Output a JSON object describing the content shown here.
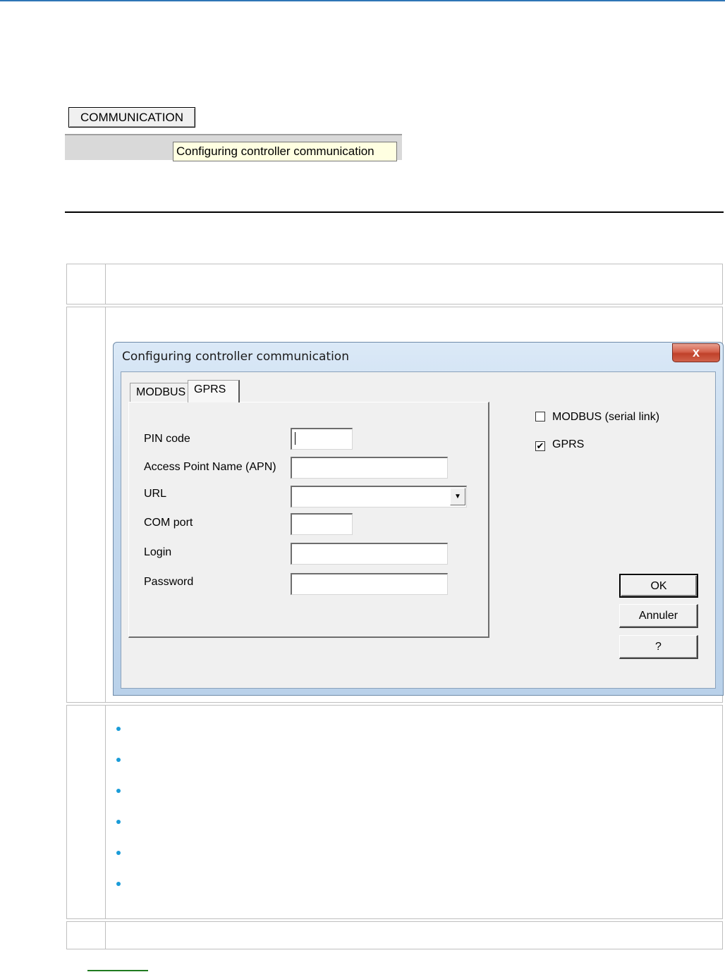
{
  "toolbar": {
    "communication_button": "COMMUNICATION",
    "tooltip": "Configuring controller communication"
  },
  "dialog": {
    "title": "Configuring controller communication",
    "close_label": "x",
    "tabs": [
      {
        "label": "MODBUS"
      },
      {
        "label": "GPRS"
      }
    ],
    "fields": {
      "pin_code": {
        "label": "PIN code",
        "value": ""
      },
      "apn": {
        "label": "Access Point Name (APN)",
        "value": ""
      },
      "url": {
        "label": "URL",
        "value": ""
      },
      "com_port": {
        "label": "COM port",
        "value": ""
      },
      "login": {
        "label": "Login",
        "value": ""
      },
      "password": {
        "label": "Password",
        "value": ""
      }
    },
    "checkboxes": {
      "modbus": {
        "label": "MODBUS (serial link)",
        "checked": false,
        "mark": ""
      },
      "gprs": {
        "label": "GPRS",
        "checked": true,
        "mark": "✔"
      }
    },
    "buttons": {
      "ok": "OK",
      "cancel": "Annuler",
      "help": "?"
    }
  },
  "colors": {
    "accent_rule": "#2e75b6",
    "bullet": "#1a9cd8",
    "tooltip_bg": "#ffffe1",
    "close_button": "#c0412a"
  },
  "icons": {
    "close": "close-icon",
    "dropdown": "chevron-down-icon",
    "bullet": "bullet-icon"
  }
}
